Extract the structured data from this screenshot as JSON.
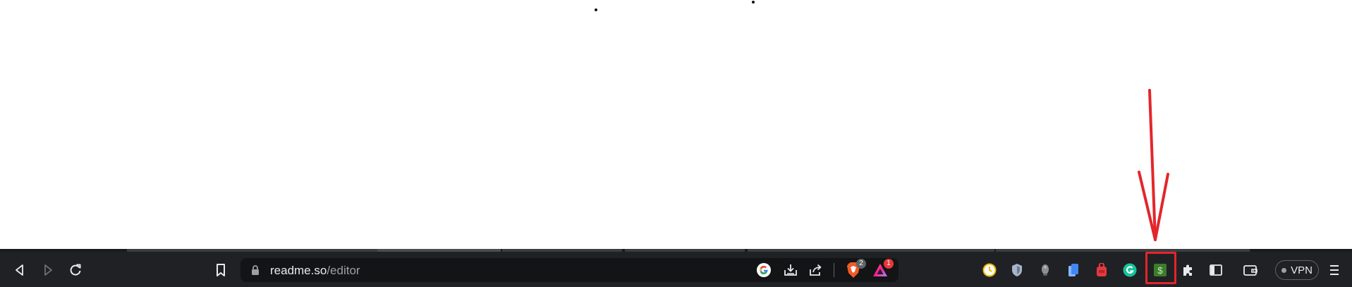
{
  "browser": {
    "address_bar": {
      "domain": "readme.so",
      "path": "/editor"
    },
    "shields_count": "2",
    "rewards_count": "1",
    "vpn_label": "VPN"
  },
  "icons": [
    "back-icon",
    "forward-icon",
    "reload-icon",
    "bookmark-icon",
    "lock-icon",
    "google-icon",
    "install-icon",
    "share-icon",
    "brave-shields-icon",
    "brave-rewards-icon",
    "clock-extension-icon",
    "shield-extension-icon",
    "bell-extension-icon",
    "docs-extension-icon",
    "backpack-extension-icon",
    "grammarly-icon",
    "dollar-extension-icon",
    "extensions-puzzle-icon",
    "sidebar-icon",
    "wallet-icon",
    "menu-icon"
  ],
  "colors": {
    "toolbar_bg": "#202124",
    "omnibox_bg": "#131416",
    "annotation_red": "#e3262b",
    "grammarly_green": "#15c39a",
    "dollar_ext_green": "#3b7d2b"
  }
}
